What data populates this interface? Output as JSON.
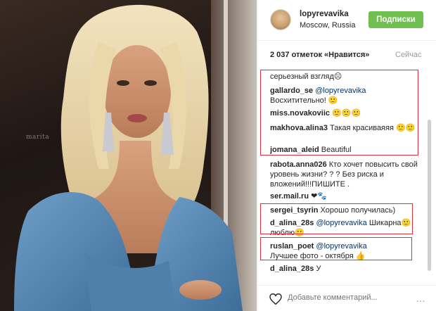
{
  "post": {
    "username": "lopyrevavika",
    "location": "Moscow, Russia",
    "follow_label": "Подписки",
    "likes": "2 037 отметок «Нравится»",
    "time": "Сейчас",
    "watermark": "marita"
  },
  "comments": [
    {
      "user": "",
      "mention": "",
      "text": "серьезный взгляд☹"
    },
    {
      "user": "gallardo_se",
      "mention": "@lopyrevavika",
      "text": "Восхитительно! 🙂"
    },
    {
      "user": "miss.novakoviic",
      "mention": "",
      "text": "🙂🙂🙂"
    },
    {
      "user": "makhova.alina3",
      "mention": "",
      "text": "Такая красиваяяя 🙂🙂"
    },
    {
      "user": "jomana_aleid",
      "mention": "",
      "text": "Beautiful"
    },
    {
      "user": "rabota.anna026",
      "mention": "",
      "text": "Кто хочет повысить свой уровень жизни? ? ? Без риска и вложений!!!ПИШИТЕ ."
    },
    {
      "user": "ser.mail.ru",
      "mention": "",
      "text": "❤︎🐾"
    },
    {
      "user": "sergei_tsyrin",
      "mention": "",
      "text": "Хорошо получилась)"
    },
    {
      "user": "d_alina_28s",
      "mention": "@lopyrevavika",
      "text": "Шикарна🙂 люблю🙂"
    },
    {
      "user": "ruslan_poet",
      "mention": "@lopyrevavika",
      "text": "Лучшее фото - октября 👍"
    },
    {
      "user": "d_alina_28s",
      "mention": "",
      "text": "У"
    }
  ],
  "footer": {
    "add_comment_placeholder": "Добавьте комментарий...",
    "more": "…"
  }
}
